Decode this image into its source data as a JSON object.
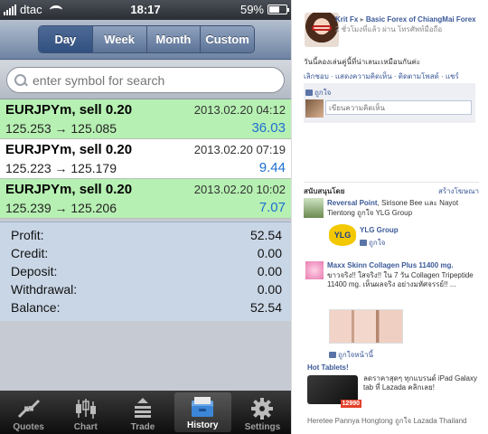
{
  "status_bar": {
    "carrier": "dtac",
    "time": "18:17",
    "battery": "59%",
    "battery_level": 0.59
  },
  "segments": [
    {
      "label": "Day",
      "active": true
    },
    {
      "label": "Week",
      "active": false
    },
    {
      "label": "Month",
      "active": false
    },
    {
      "label": "Custom",
      "active": false
    }
  ],
  "search": {
    "placeholder": "enter symbol for search"
  },
  "orders": [
    {
      "symbol": "EURJPYm, sell 0.20",
      "time": "2013.02.20 04:12",
      "prices": "125.253 → 125.085",
      "profit": "36.03",
      "bg": "#b6f0b2"
    },
    {
      "symbol": "EURJPYm, sell 0.20",
      "time": "2013.02.20 07:19",
      "prices": "125.223 → 125.179",
      "profit": "9.44",
      "bg": "#ffffff"
    },
    {
      "symbol": "EURJPYm, sell 0.20",
      "time": "2013.02.20 10:02",
      "prices": "125.239 → 125.206",
      "profit": "7.07",
      "bg": "#b6f0b2"
    }
  ],
  "summary": [
    {
      "label": "Profit:",
      "value": "52.54"
    },
    {
      "label": "Credit:",
      "value": "0.00"
    },
    {
      "label": "Deposit:",
      "value": "0.00"
    },
    {
      "label": "Withdrawal:",
      "value": "0.00"
    },
    {
      "label": "Balance:",
      "value": "52.54"
    }
  ],
  "tabs": [
    {
      "label": "Quotes",
      "icon": "quotes-icon",
      "active": false
    },
    {
      "label": "Chart",
      "icon": "chart-icon",
      "active": false
    },
    {
      "label": "Trade",
      "icon": "trade-icon",
      "active": false
    },
    {
      "label": "History",
      "icon": "history-icon",
      "active": true
    },
    {
      "label": "Settings",
      "icon": "gear-icon",
      "active": false
    }
  ],
  "fb": {
    "author": "Krit Fx",
    "arrow": "▸",
    "group": "Basic Forex of ChiangMai Forex",
    "meta": "2 ชั่วโมงที่แล้ว ผ่าน โทรศัพท์มือถือ",
    "post_text": "วันนี้ลองเล่นคู่นี้ที่น่าเลนะเหมือนกันค่ะ",
    "actions": "เลิกชอบ · แสดงความคิดเห็น · ติดตามโพสต์ · แชร์",
    "likes": "ถูกใจ",
    "comment_placeholder": "เขียนความคิดเห็น",
    "sponsored": "สนับสนุนโดย",
    "create_ad": "สร้างโฆษณา",
    "ad1": {
      "name": "Reversal Point",
      "text": ", Sirisone Bee และ Nayot Tientong ถูกใจ YLG Group"
    },
    "ad2": {
      "logo": "YLG",
      "name": "YLG Group",
      "like": "ถูกใจ"
    },
    "ad3": {
      "title": "Maxx Skinn Collagen Plus 11400 mg.",
      "body": "ขาวจริง!! ใสจริง!! ใน 7 วัน Collagen Tripeptide 11400 mg. เห็นผลจริง อย่างมหัศจรรย์!! ...",
      "like": "ถูกใจหน้านี้"
    },
    "ad4": {
      "title": "Hot Tablets!",
      "price": "12990",
      "text": "ลดราคาสุดๆ ทุกแบรนด์ iPad Galaxy tab ที่ Lazada คลิกเลย!",
      "footer": "Heretee Pannya Hongtong ถูกใจ Lazada Thailand"
    }
  }
}
